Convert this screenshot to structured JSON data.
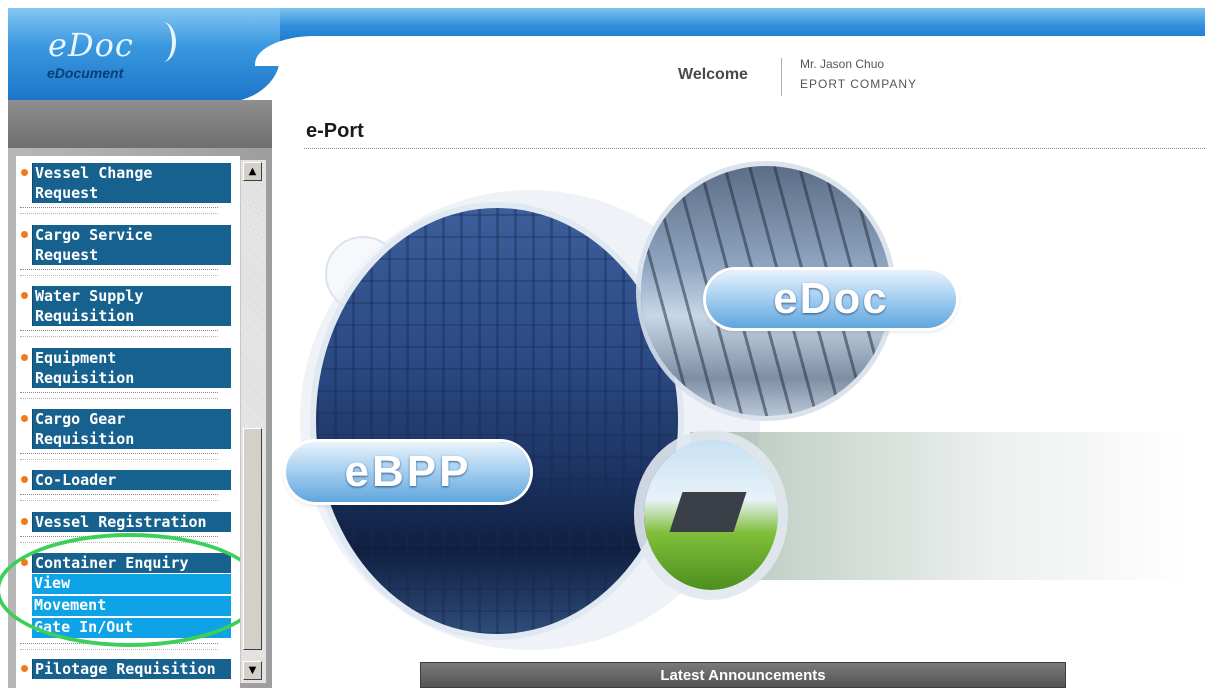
{
  "header": {
    "logo_main": "eDoc",
    "logo_sub": "eDocument",
    "welcome_label": "Welcome",
    "user_name": "Mr. Jason Chuo",
    "company": "EPORT COMPANY"
  },
  "page": {
    "title": "e-Port"
  },
  "sidebar": {
    "items": [
      {
        "label": "Vessel Change\nRequest"
      },
      {
        "label": "Cargo Service\nRequest"
      },
      {
        "label": "Water Supply\nRequisition"
      },
      {
        "label": "Equipment\nRequisition"
      },
      {
        "label": "Cargo Gear\nRequisition"
      },
      {
        "label": "Co-Loader"
      },
      {
        "label": "Vessel Registration"
      },
      {
        "label": "Container Enquiry"
      },
      {
        "label": "Pilotage Requisition"
      }
    ],
    "container_enquiry_subitems": [
      {
        "label": "View"
      },
      {
        "label": "Movement"
      },
      {
        "label": "Gate In/Out"
      }
    ],
    "scroll_up_glyph": "▲",
    "scroll_down_glyph": "▼"
  },
  "hero": {
    "badge_edoc": "eDoc",
    "badge_ebpp": "eBPP"
  },
  "announcements": {
    "title": "Latest Announcements"
  },
  "colors": {
    "header_blue": "#2f8fdc",
    "menu_item_bg": "#17618f",
    "submenu_bg": "#0ea2e6",
    "bullet_orange": "#f07a18",
    "highlight_green": "#3ccf5a",
    "announce_bar": "#666666"
  }
}
